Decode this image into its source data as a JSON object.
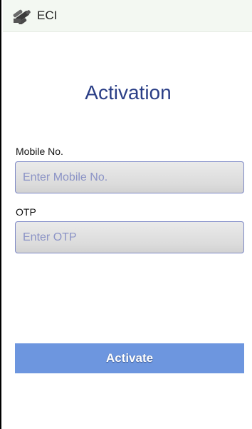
{
  "header": {
    "app_name": "ECI",
    "logo_icon": "voting-finger-icon"
  },
  "page": {
    "title": "Activation"
  },
  "form": {
    "mobile": {
      "label": "Mobile No.",
      "placeholder": "Enter Mobile No.",
      "value": ""
    },
    "otp": {
      "label": "OTP",
      "placeholder": "Enter OTP",
      "value": ""
    },
    "submit_label": "Activate"
  },
  "colors": {
    "header_bg": "#f3f8f2",
    "title_color": "#2a3e86",
    "input_border": "#7d88c6",
    "placeholder": "#8b93c6",
    "button_bg": "#6d96df"
  }
}
